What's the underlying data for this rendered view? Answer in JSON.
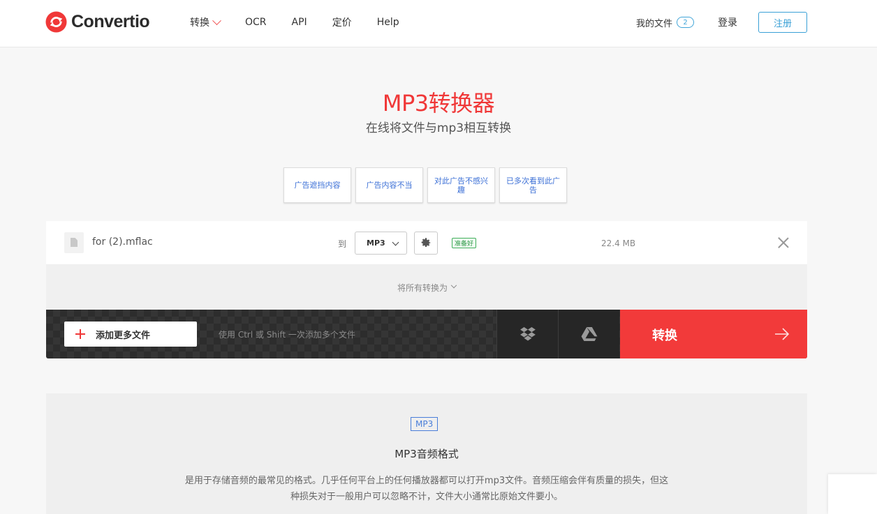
{
  "brand": {
    "name": "Convertio"
  },
  "nav": {
    "items": [
      {
        "label": "转换",
        "has_dropdown": true
      },
      {
        "label": "OCR"
      },
      {
        "label": "API"
      },
      {
        "label": "定价"
      },
      {
        "label": "Help"
      }
    ]
  },
  "account": {
    "my_files_label": "我的文件",
    "my_files_count": "2",
    "login_label": "登录",
    "signup_label": "注册"
  },
  "hero": {
    "title": "MP3转换器",
    "subtitle": "在线将文件与mp3相互转换"
  },
  "ad_feedback": {
    "buttons": [
      "广告遮挡内容",
      "广告内容不当",
      "对此广告不感兴趣",
      "已多次看到此广告"
    ]
  },
  "converter": {
    "file": {
      "name": "for (2).mflac",
      "to_label": "到",
      "format": "MP3",
      "status": "准备好",
      "size": "22.4 MB"
    },
    "convert_all_label": "将所有转换为",
    "add_files_label": "添加更多文件",
    "hint": "使用 Ctrl 或 Shift 一次添加多个文件",
    "cloud_icons": [
      "dropbox-icon",
      "google-drive-icon"
    ],
    "convert_label": "转换"
  },
  "info": {
    "badge": "MP3",
    "title": "MP3音频格式",
    "description": "是用于存储音频的最常见的格式。几乎任何平台上的任何播放器都可以打开mp3文件。音频压缩会伴有质量的损失，但这种损失对于一般用户可以忽略不计，文件大小通常比原始文件要小。"
  },
  "colors": {
    "brand_red": "#f23a3a",
    "link_blue": "#3b6fd6",
    "status_green": "#2f9a48"
  }
}
